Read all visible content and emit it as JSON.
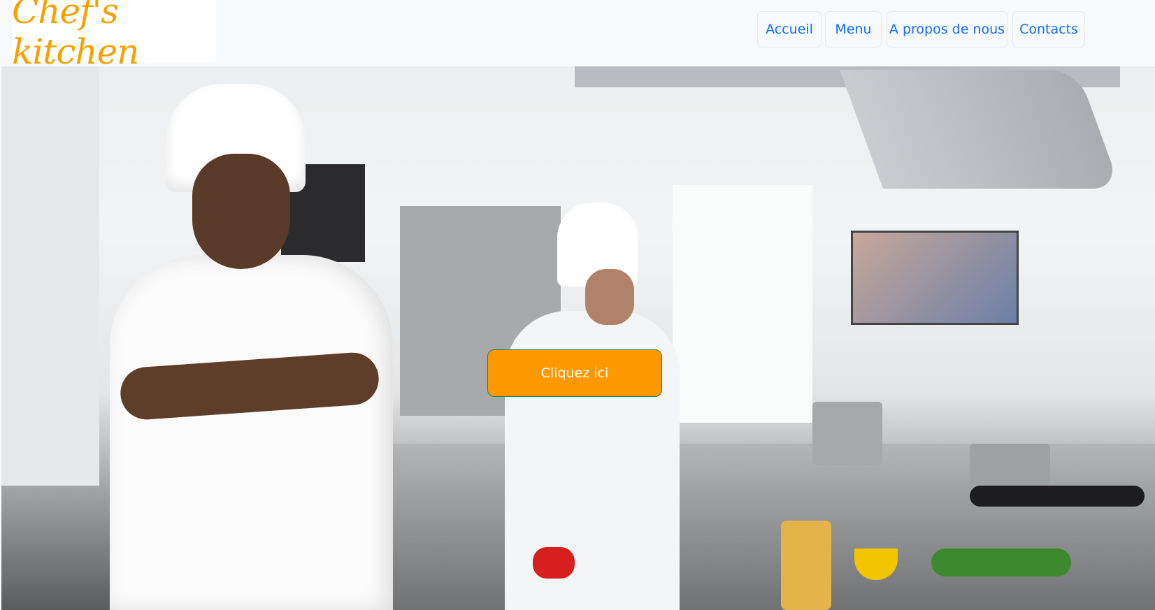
{
  "header": {
    "logo_text": "Chef's kitchen"
  },
  "nav": [
    {
      "label": "Accueil"
    },
    {
      "label": "Menu"
    },
    {
      "label": "A propos de nous"
    },
    {
      "label": "Contacts"
    }
  ],
  "hero": {
    "cta_label": "Cliquez ici"
  },
  "colors": {
    "accent": "#fd9800",
    "link": "#0d6efd",
    "logo": "#f7a000"
  }
}
